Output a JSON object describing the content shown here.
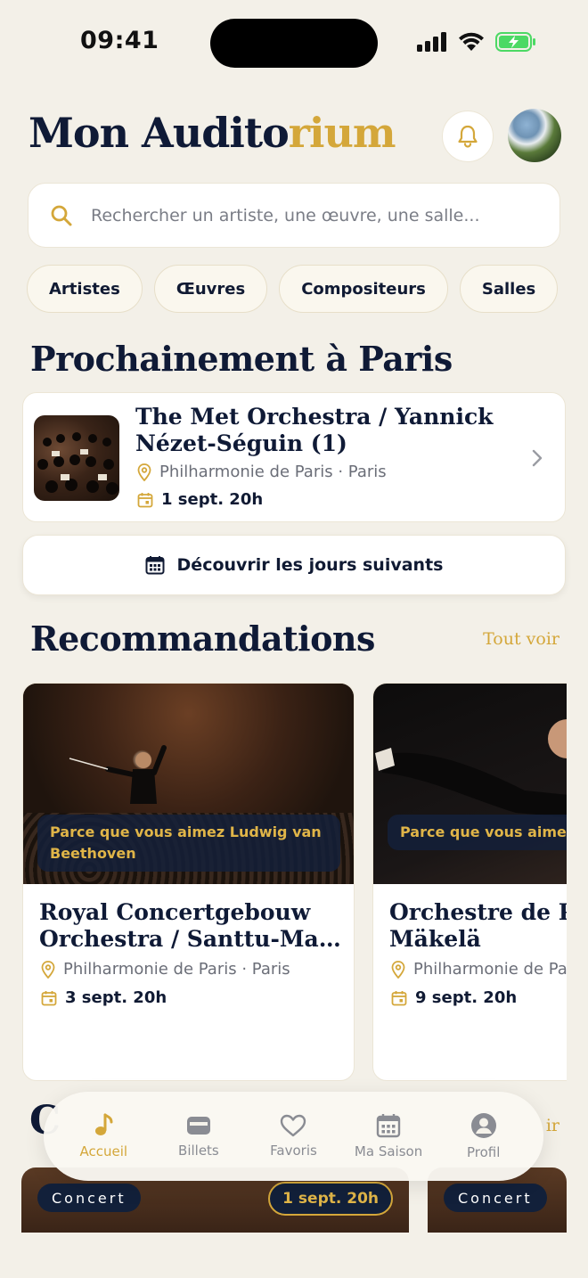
{
  "status_bar": {
    "time": "09:41"
  },
  "header": {
    "title_part1": "Mon Audito",
    "title_part2": "rium"
  },
  "search": {
    "placeholder": "Rechercher un artiste, une œuvre, une salle..."
  },
  "chips": [
    "Artistes",
    "Œuvres",
    "Compositeurs",
    "Salles"
  ],
  "upcoming": {
    "section_title": "Prochainement à Paris",
    "title_line1": "The Met Orchestra / Yannick",
    "title_line2": "Nézet-Séguin (1)",
    "venue": "Philharmonie de Paris · Paris",
    "date": "1 sept. 20h",
    "discover_label": "Découvrir les jours suivants"
  },
  "recommendations": {
    "section_title": "Recommandations",
    "see_all": "Tout voir",
    "cards": [
      {
        "reason": "Parce que vous aimez Ludwig van Beethoven",
        "title_line1": "Royal Concertgebouw",
        "title_line2": "Orchestra / Santtu-Matia...",
        "venue": "Philharmonie de Paris · Paris",
        "date": "3 sept. 20h"
      },
      {
        "reason": "Parce que vous aimez Paris",
        "title_line1": "Orchestre de Pa",
        "title_line2": "Mäkelä",
        "venue": "Philharmonie de Pa",
        "date": "9 sept. 20h"
      }
    ]
  },
  "next_section": {
    "title_initial": "C",
    "link_fragment": "ir",
    "cards": [
      {
        "tag": "Concert",
        "date": "1 sept. 20h"
      },
      {
        "tag": "Concert"
      }
    ]
  },
  "tabbar": {
    "active": "Accueil",
    "items": [
      "Accueil",
      "Billets",
      "Favoris",
      "Ma Saison",
      "Profil"
    ]
  },
  "colors": {
    "accent": "#d4a73a",
    "navy": "#0f1a36",
    "background": "#f3f0e8",
    "battery": "#4cd964"
  }
}
